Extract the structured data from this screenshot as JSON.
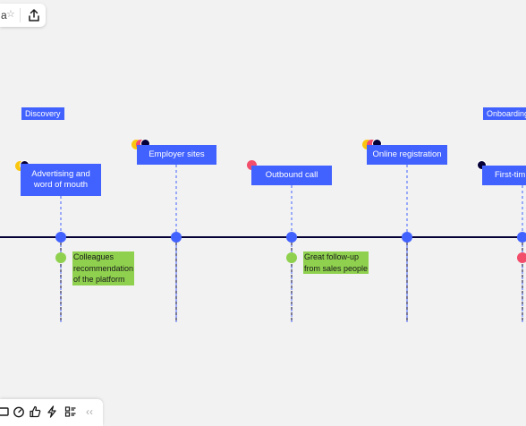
{
  "colors": {
    "canvas_bg": "#f2f2f2",
    "accent_blue": "#4262ff",
    "sticky_green": "#8fd14f",
    "timeline_navy": "#050038",
    "marker_green": "#8fd14f",
    "marker_red": "#f24e6b",
    "avatar_yellow": "#fac710",
    "avatar_pink": "#f24e6b"
  },
  "top_toolbar": {
    "title_fragment": "a",
    "star_icon": "star-icon",
    "share_icon": "share-icon",
    "star_glyph": "☆"
  },
  "stages": [
    {
      "label": "Discovery"
    },
    {
      "label": "Onboarding"
    }
  ],
  "touchpoints": [
    {
      "label": "Advertising and\nword of mouth"
    },
    {
      "label": "Employer sites"
    },
    {
      "label": "Outbound call"
    },
    {
      "label": "Online registration"
    },
    {
      "label": "First-tim"
    }
  ],
  "notes": [
    {
      "text": "Colleagues\nrecommendation\nof the platform"
    },
    {
      "text": "Great follow-up\nfrom sales people"
    }
  ],
  "bottom_toolbar": {
    "icons": [
      "frame-icon",
      "timer-icon",
      "like-icon",
      "lightning-icon",
      "list-icon",
      "collapse-icon"
    ],
    "collapse_glyph": "‹‹"
  }
}
